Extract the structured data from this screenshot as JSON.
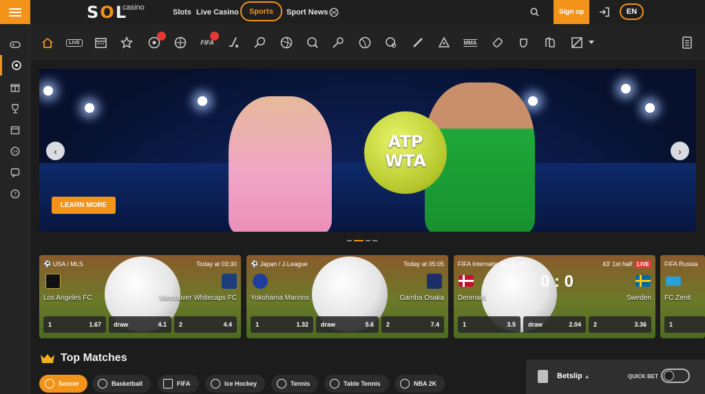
{
  "header": {
    "logo": "SOL",
    "logo_sub": "casino",
    "nav": [
      "Slots",
      "Live Casino",
      "Sports",
      "Sport News"
    ],
    "signup": "Sign up",
    "language": "EN"
  },
  "sidebar": {
    "items": [
      "gamepad-icon",
      "soccer-icon",
      "gift-icon",
      "trophy-icon",
      "calendar-icon",
      "24h-icon",
      "chat-icon",
      "help-icon"
    ],
    "active_index": 1
  },
  "sportbar": {
    "icons": [
      "home-icon",
      "live-icon",
      "calendar-icon",
      "star-icon",
      "soccer-hot-icon",
      "basketball-icon",
      "fifa-hot-icon",
      "hockey-icon",
      "tennis-icon",
      "volleyball-icon",
      "table-tennis-icon",
      "badminton-icon",
      "rugby-icon",
      "golf-icon",
      "cricket-icon",
      "snooker-icon",
      "mma-icon",
      "darts-icon",
      "boxing-icon",
      "esport-icon",
      "dota-icon",
      "chevron-down-icon",
      "betslip-icon"
    ],
    "live_label": "LIVE",
    "fifa_label": "FIFA",
    "mma_label": "MMA"
  },
  "banner": {
    "ball_line1": "ATP",
    "ball_line2": "WTA",
    "cta": "LEARN MORE",
    "slides": 4,
    "active_slide": 1
  },
  "matches": [
    {
      "league": "USA / MLS",
      "time": "Today at 03:30",
      "home": "Los Angeles FC",
      "away": "Vancouver Whitecaps FC",
      "odds": [
        {
          "label": "1",
          "value": "1.67"
        },
        {
          "label": "draw",
          "value": "4.1"
        },
        {
          "label": "2",
          "value": "4.4"
        }
      ]
    },
    {
      "league": "Japan / J.League",
      "time": "Today at 05:05",
      "home": "Yokohama Marinos",
      "away": "Gamba Osaka",
      "odds": [
        {
          "label": "1",
          "value": "1.32"
        },
        {
          "label": "draw",
          "value": "5.6"
        },
        {
          "label": "2",
          "value": "7.4"
        }
      ]
    },
    {
      "league": "International / EURO",
      "time": "43' 1st half",
      "live": "LIVE",
      "home": "Denmark",
      "away": "Sweden",
      "score": "0 : 0",
      "odds": [
        {
          "label": "1",
          "value": "3.5"
        },
        {
          "label": "draw",
          "value": "2.04"
        },
        {
          "label": "2",
          "value": "3.36"
        }
      ]
    },
    {
      "league": "Russia",
      "home": "FC Zenit",
      "odds": [
        {
          "label": "1",
          "value": ""
        }
      ]
    }
  ],
  "top_matches": {
    "title": "Top Matches",
    "chips": [
      "Soccer",
      "Basketball",
      "FIFA",
      "Ice Hockey",
      "Tennis",
      "Table Tennis",
      "NBA 2K"
    ]
  },
  "betslip": {
    "label": "Betslip",
    "quick_bet": "QUICK BET"
  },
  "colors": {
    "accent": "#f2941a",
    "background": "#1c1c1c",
    "live": "#e53935"
  }
}
